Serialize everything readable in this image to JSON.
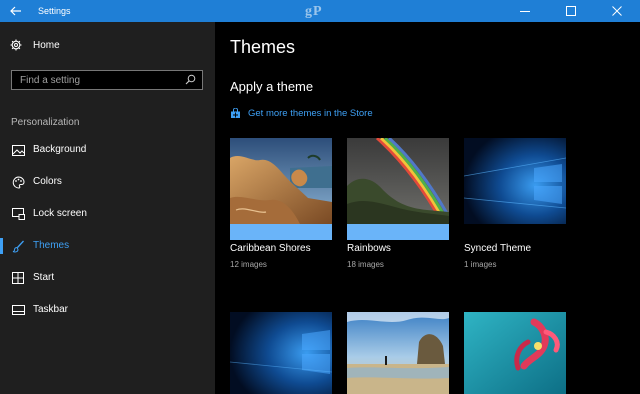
{
  "window": {
    "title": "Settings",
    "watermark": "gP"
  },
  "sidebar": {
    "home_label": "Home",
    "search_placeholder": "Find a setting",
    "section_header": "Personalization",
    "items": [
      {
        "label": "Background",
        "icon": "picture-icon"
      },
      {
        "label": "Colors",
        "icon": "palette-icon"
      },
      {
        "label": "Lock screen",
        "icon": "lock-screen-icon"
      },
      {
        "label": "Themes",
        "icon": "brush-icon",
        "active": true
      },
      {
        "label": "Start",
        "icon": "start-icon"
      },
      {
        "label": "Taskbar",
        "icon": "taskbar-icon"
      }
    ]
  },
  "main": {
    "title": "Themes",
    "subtitle": "Apply a theme",
    "store_link": "Get more themes in the Store",
    "themes": [
      {
        "name": "Caribbean Shores",
        "count": "12 images",
        "accent": "#6ab4f9"
      },
      {
        "name": "Rainbows",
        "count": "18 images",
        "accent": "#6ab4f9"
      },
      {
        "name": "Synced Theme",
        "count": "1 images",
        "accent": "#000000"
      },
      {
        "name": "",
        "count": "",
        "accent": ""
      },
      {
        "name": "",
        "count": "",
        "accent": ""
      },
      {
        "name": "",
        "count": "",
        "accent": ""
      }
    ]
  },
  "colors": {
    "titlebar": "#1f7fd6",
    "accent": "#3ea0f5",
    "sidebar": "#1f1f1f"
  }
}
